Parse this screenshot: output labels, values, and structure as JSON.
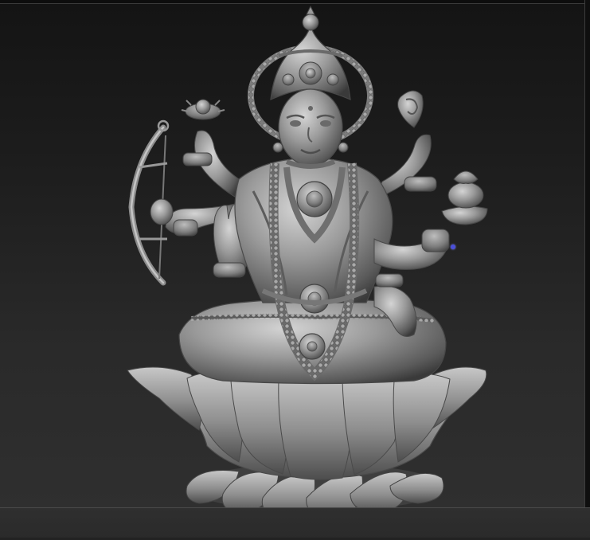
{
  "viewport": {
    "background_top": "#141414",
    "background_bottom": "#303030",
    "model_color": "#8d8d8d",
    "model_shadow": "#3b3b3b",
    "model_highlight": "#cfcfcf",
    "gizmo_color": "#4a4fd9"
  },
  "model": {
    "icon": "sculpt-mesh-icon"
  }
}
